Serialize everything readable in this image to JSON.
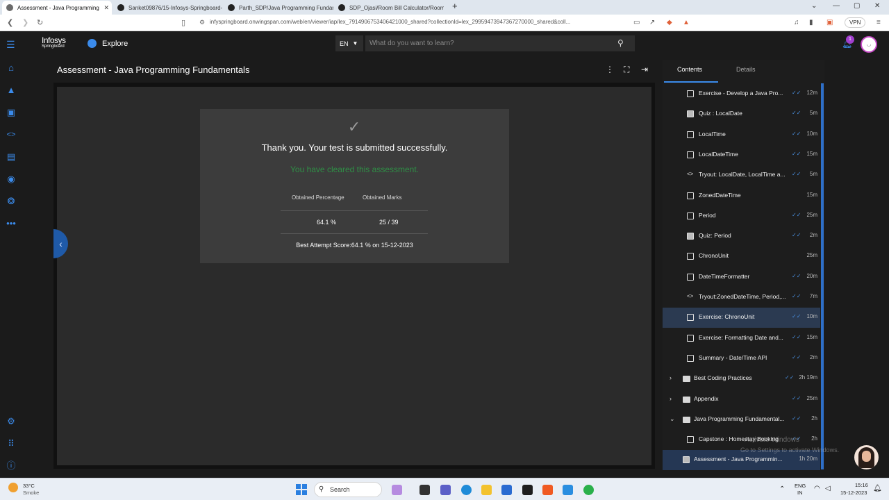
{
  "browser": {
    "tabs": [
      {
        "title": "Assessment - Java Programming",
        "active": true,
        "fav_color": "#6b6b6b"
      },
      {
        "title": "Sanket09876/15-Infosys-Springboard-",
        "active": false,
        "fav_color": "#222222"
      },
      {
        "title": "Parth_SDP/Java Programming Fundam",
        "active": false,
        "fav_color": "#222222"
      },
      {
        "title": "SDP_Ojasi/Room Bill Calculator/Room",
        "active": false,
        "fav_color": "#222222"
      }
    ],
    "url": "infyspringboard.onwingspan.com/web/en/viewer/iap/lex_7914906753406421000_shared?collectionId=lex_29959473947367270000_shared&coll...",
    "vpn_label": "VPN"
  },
  "header": {
    "logo_line1": "Infosys",
    "logo_line2": "Springboard",
    "explore_label": "Explore",
    "language": "EN",
    "search_placeholder": "What do you want to learn?",
    "notification_count": "1"
  },
  "content": {
    "title": "Assessment - Java Programming Fundamentals",
    "result": {
      "message": "Thank you. Your test is submitted successfully.",
      "status": "You have cleared this assessment.",
      "col_percentage": "Obtained Percentage",
      "col_marks": "Obtained Marks",
      "percentage": "64.1 %",
      "marks": "25 / 39",
      "best_attempt": "Best Attempt Score:64.1 % on 15-12-2023"
    }
  },
  "panel": {
    "tab_contents": "Contents",
    "tab_details": "Details",
    "items": [
      {
        "type": "doc",
        "label": "Exercise - Develop a Java Pro...",
        "done": true,
        "duration": "12m"
      },
      {
        "type": "quiz",
        "label": "Quiz : LocalDate",
        "done": true,
        "duration": "5m"
      },
      {
        "type": "doc",
        "label": "LocalTime",
        "done": true,
        "duration": "10m"
      },
      {
        "type": "doc",
        "label": "LocalDateTime",
        "done": true,
        "duration": "15m"
      },
      {
        "type": "code",
        "label": "Tryout: LocalDate, LocalTime a...",
        "done": true,
        "duration": "5m"
      },
      {
        "type": "doc",
        "label": "ZonedDateTime",
        "done": false,
        "duration": "15m"
      },
      {
        "type": "doc",
        "label": "Period",
        "done": true,
        "duration": "25m"
      },
      {
        "type": "quiz",
        "label": "Quiz: Period",
        "done": true,
        "duration": "2m"
      },
      {
        "type": "doc",
        "label": "ChronoUnit",
        "done": false,
        "duration": "25m"
      },
      {
        "type": "doc",
        "label": "DateTimeFormatter",
        "done": true,
        "duration": "20m"
      },
      {
        "type": "code",
        "label": "Tryout:ZonedDateTime, Period,...",
        "done": true,
        "duration": "7m"
      },
      {
        "type": "doc",
        "label": "Exercise: ChronoUnit",
        "done": true,
        "duration": "10m",
        "selected": true
      },
      {
        "type": "doc",
        "label": "Exercise: Formatting Date and...",
        "done": true,
        "duration": "15m"
      },
      {
        "type": "doc",
        "label": "Summary - Date/Time API",
        "done": true,
        "duration": "2m"
      },
      {
        "type": "folder",
        "arrow": "›",
        "label": "Best Coding Practices",
        "done": true,
        "duration": "2h 19m"
      },
      {
        "type": "folder",
        "arrow": "›",
        "label": "Appendix",
        "done": true,
        "duration": "25m"
      },
      {
        "type": "folder",
        "arrow": "⌄",
        "label": "Java Programming Fundamental...",
        "done": true,
        "duration": "2h"
      },
      {
        "type": "doc",
        "label": "Capstone : Homestay Booking",
        "done": true,
        "duration": "2h"
      },
      {
        "type": "assess",
        "label": "Assessment - Java Programmin...",
        "done": false,
        "duration": "1h 20m",
        "active": true
      }
    ],
    "watermark_title": "Activate Windows",
    "watermark_sub": "Go to Settings to activate Windows."
  },
  "taskbar": {
    "weather_temp": "33°C",
    "weather_desc": "Smoke",
    "search_label": "Search",
    "lang1": "ENG",
    "lang2": "IN",
    "time": "15:16",
    "date": "15-12-2023"
  },
  "colors": {
    "accent": "#3b8beb",
    "success": "#2f8f46",
    "selected_row": "#2b3a51"
  }
}
